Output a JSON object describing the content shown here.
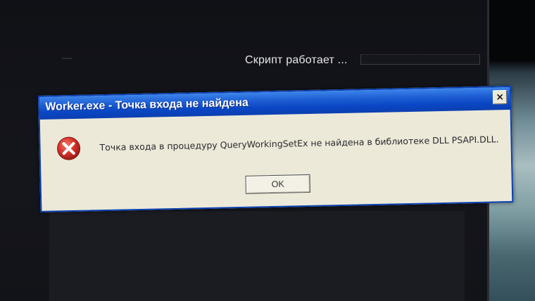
{
  "background": {
    "script_status_label": "Скрипт работает ...",
    "progress_fraction": 0
  },
  "dialog": {
    "title": "Worker.exe - Точка входа не найдена",
    "close_label": "×",
    "icon": "error-icon",
    "message": "Точка входа в процедуру QueryWorkingSetEx не найдена в библиотеке DLL PSAPI.DLL.",
    "ok_label": "OK"
  },
  "colors": {
    "titlebar_blue": "#0a46c4",
    "dialog_face": "#ece9d8",
    "error_red": "#d8332a"
  }
}
